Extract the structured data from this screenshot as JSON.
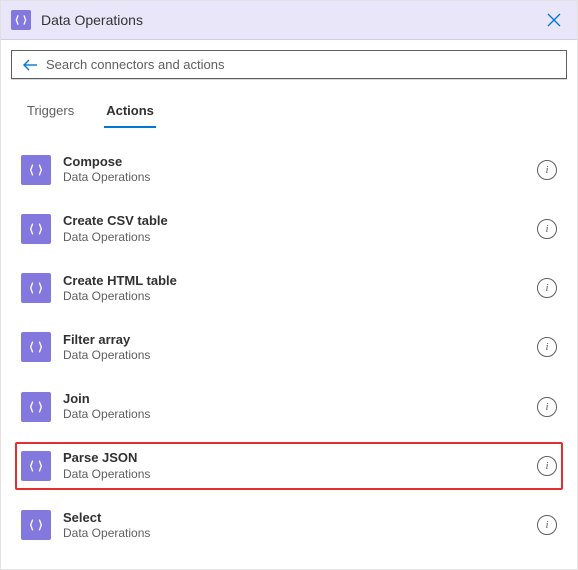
{
  "header": {
    "title": "Data Operations"
  },
  "search": {
    "placeholder": "Search connectors and actions",
    "value": ""
  },
  "tabs": [
    {
      "label": "Triggers",
      "active": false
    },
    {
      "label": "Actions",
      "active": true
    }
  ],
  "actions": {
    "subtitle": "Data Operations",
    "items": [
      {
        "name": "Compose",
        "highlighted": false
      },
      {
        "name": "Create CSV table",
        "highlighted": false
      },
      {
        "name": "Create HTML table",
        "highlighted": false
      },
      {
        "name": "Filter array",
        "highlighted": false
      },
      {
        "name": "Join",
        "highlighted": false
      },
      {
        "name": "Parse JSON",
        "highlighted": true
      },
      {
        "name": "Select",
        "highlighted": false
      }
    ]
  },
  "icons": {
    "info_glyph": "i"
  }
}
